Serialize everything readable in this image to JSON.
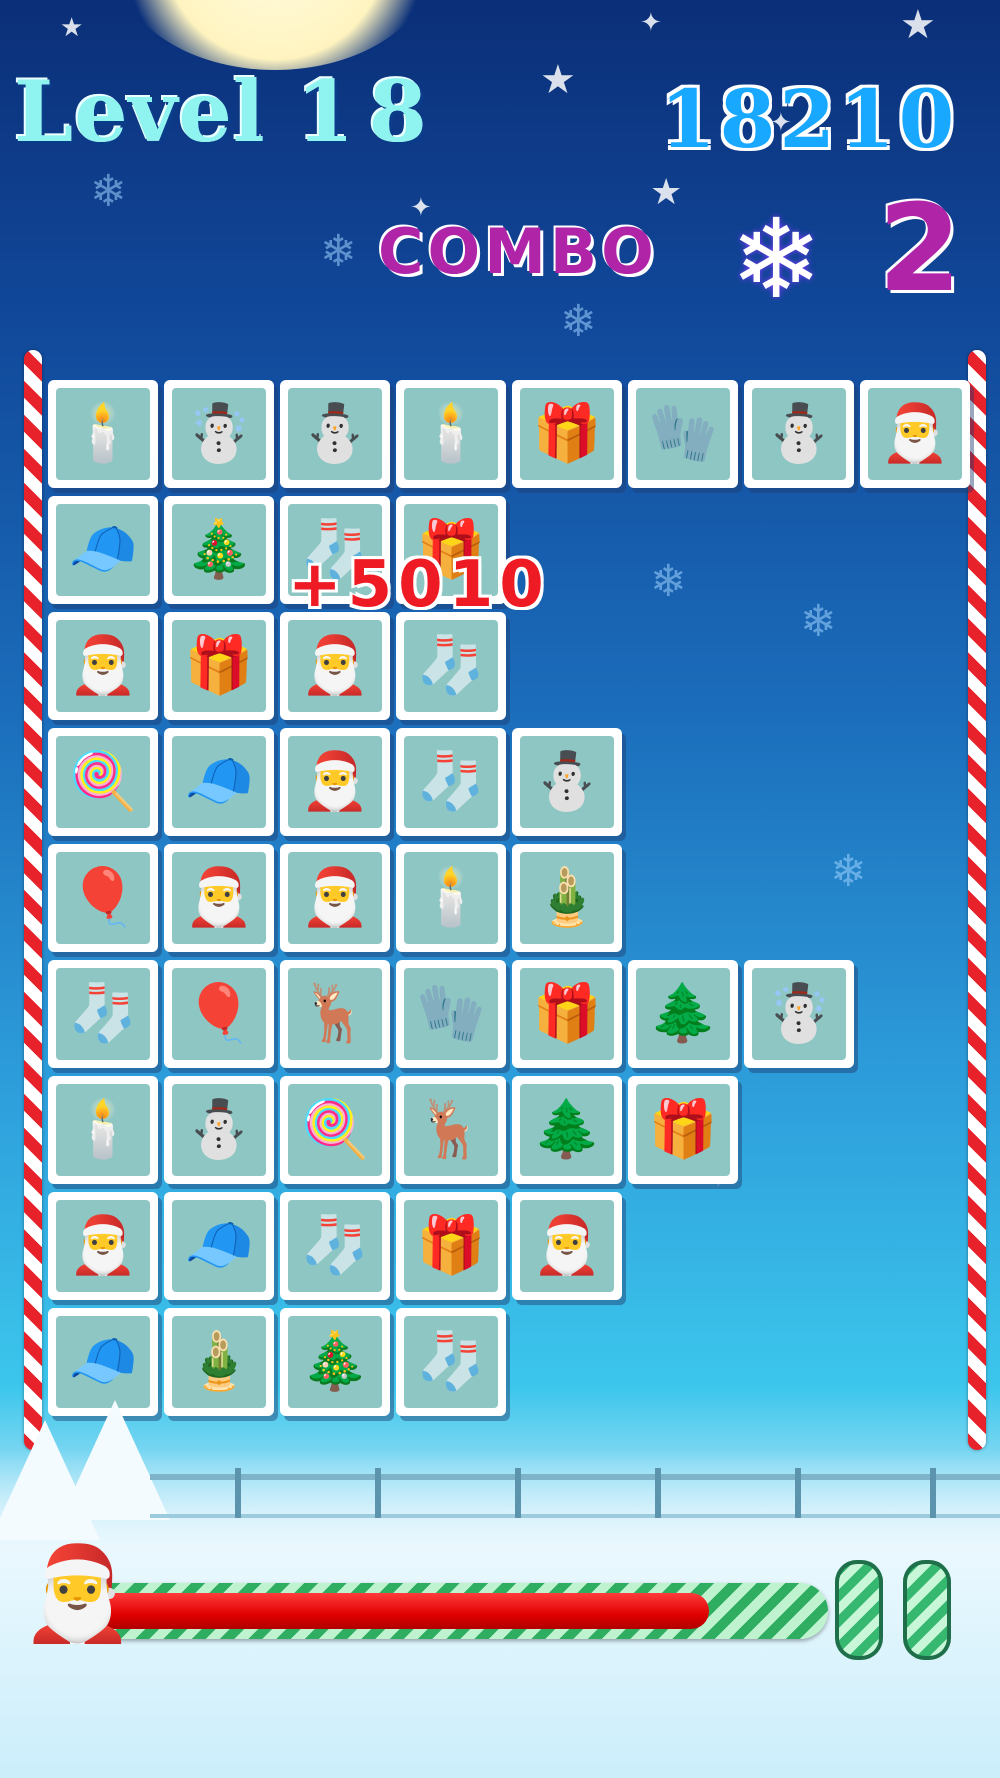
{
  "hud": {
    "level_label": "Level",
    "level_number": "18",
    "score": "18210",
    "combo_label": "COMBO",
    "combo_count": "2",
    "score_popup": "+5010"
  },
  "timer": {
    "remaining_fraction": 0.85,
    "fill_color": "#e00000"
  },
  "tile_icons": {
    "candle": "🕯️",
    "snowcouple": "☃️",
    "snowman": "⛄",
    "gift_yellow": "🎁",
    "mitten": "🧤",
    "santa_box": "🎅",
    "santa_hat": "🧢",
    "xmas_tree": "🎄",
    "stocking": "🧦",
    "candy_cane": "🍭",
    "santa": "🎅",
    "ornaments": "🎈",
    "wreath": "🎍",
    "reindeer": "🦌",
    "gift_purple": "🎁",
    "striped_tree": "🌲"
  },
  "grid": [
    [
      "candle",
      "snowcouple",
      "snowman",
      "candle",
      "gift_yellow",
      "mitten",
      "snowman",
      "santa_box"
    ],
    [
      "santa_hat",
      "xmas_tree",
      "stocking",
      "gift_yellow"
    ],
    [
      "santa_box",
      "gift_yellow",
      "santa_box",
      "stocking"
    ],
    [
      "candy_cane",
      "santa_hat",
      "santa",
      "stocking",
      "snowman"
    ],
    [
      "ornaments",
      "santa",
      "santa_box",
      "candle",
      "wreath"
    ],
    [
      "stocking",
      "ornaments",
      "reindeer",
      "mitten",
      "gift_purple",
      "striped_tree",
      "snowcouple"
    ],
    [
      "candle",
      "snowman",
      "candy_cane",
      "reindeer",
      "striped_tree",
      "gift_yellow"
    ],
    [
      "santa",
      "santa_hat",
      "stocking",
      "gift_purple",
      "santa"
    ],
    [
      "santa_hat",
      "wreath",
      "xmas_tree",
      "stocking"
    ]
  ]
}
